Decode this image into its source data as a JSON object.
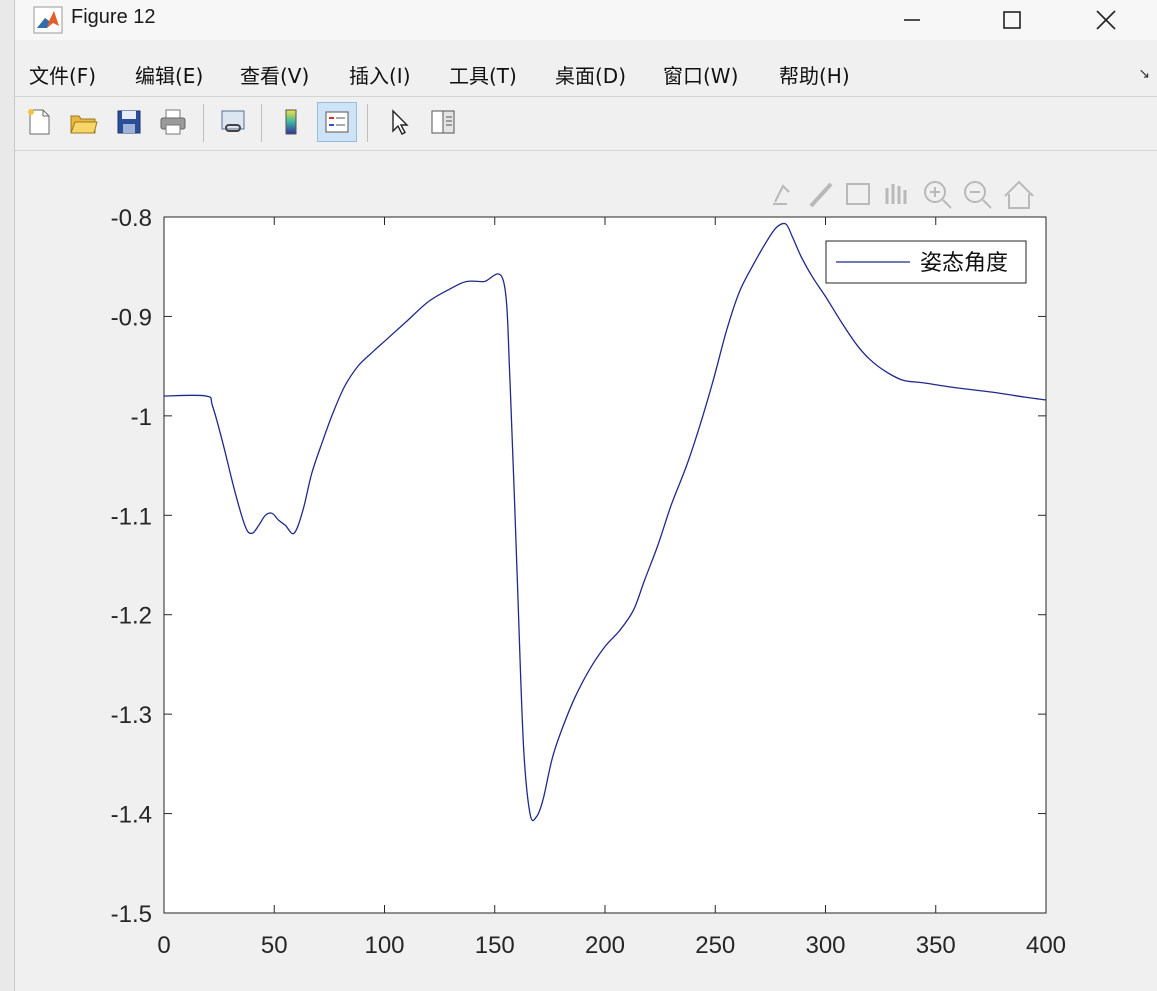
{
  "window": {
    "title": "Figure 12"
  },
  "menu": {
    "items": [
      "文件(F)",
      "编辑(E)",
      "查看(V)",
      "插入(I)",
      "工具(T)",
      "桌面(D)",
      "窗口(W)",
      "帮助(H)"
    ]
  },
  "toolbar": {
    "icons": [
      "new-figure-icon",
      "open-file-icon",
      "save-icon",
      "print-icon",
      "link-plot-icon",
      "colorbar-icon",
      "legend-icon",
      "pointer-icon",
      "property-editor-icon"
    ]
  },
  "axes_toolbar": {
    "icons": [
      "export-icon",
      "brush-icon",
      "data-tips-icon",
      "pan-icon",
      "zoom-in-icon",
      "zoom-out-icon",
      "home-icon"
    ]
  },
  "colors": {
    "line": "#1f2a8a",
    "axes_bg": "#ffffff",
    "figure_bg": "#f0f0f0"
  },
  "chart_data": {
    "type": "line",
    "xlim": [
      0,
      400
    ],
    "ylim": [
      -1.5,
      -0.8
    ],
    "xticks": [
      0,
      50,
      100,
      150,
      200,
      250,
      300,
      350,
      400
    ],
    "yticks": [
      -0.8,
      -0.9,
      -1,
      -1.1,
      -1.2,
      -1.3,
      -1.4,
      -1.5
    ],
    "xtick_labels": [
      "0",
      "50",
      "100",
      "150",
      "200",
      "250",
      "300",
      "350",
      "400"
    ],
    "ytick_labels": [
      "-0.8",
      "-0.9",
      "-1",
      "-1.1",
      "-1.2",
      "-1.3",
      "-1.4",
      "-1.5"
    ],
    "grid": false,
    "legend_position": "top-right",
    "series": [
      {
        "name": "姿态角度",
        "x": [
          0,
          19,
          22,
          27,
          32,
          37,
          40,
          43,
          46,
          49,
          52,
          55,
          59,
          63,
          67,
          72,
          77,
          82,
          88,
          95,
          100,
          110,
          120,
          130,
          137,
          145,
          154,
          157,
          160,
          163,
          166,
          169,
          172,
          176,
          180,
          186,
          193,
          200,
          207,
          213,
          218,
          224,
          230,
          237,
          243,
          249,
          255,
          261,
          268,
          274,
          278,
          282,
          285,
          289,
          294,
          300,
          307,
          314,
          320,
          327,
          335,
          345,
          360,
          375,
          390,
          400
        ],
        "y": [
          -0.98,
          -0.98,
          -0.99,
          -1.03,
          -1.075,
          -1.112,
          -1.118,
          -1.11,
          -1.1,
          -1.098,
          -1.105,
          -1.11,
          -1.118,
          -1.095,
          -1.058,
          -1.025,
          -0.995,
          -0.97,
          -0.95,
          -0.935,
          -0.925,
          -0.905,
          -0.885,
          -0.872,
          -0.865,
          -0.865,
          -0.865,
          -0.97,
          -1.15,
          -1.33,
          -1.4,
          -1.403,
          -1.385,
          -1.345,
          -1.318,
          -1.285,
          -1.255,
          -1.232,
          -1.215,
          -1.195,
          -1.165,
          -1.13,
          -1.09,
          -1.05,
          -1.01,
          -0.965,
          -0.915,
          -0.875,
          -0.845,
          -0.822,
          -0.81,
          -0.807,
          -0.82,
          -0.84,
          -0.86,
          -0.88,
          -0.905,
          -0.928,
          -0.943,
          -0.955,
          -0.964,
          -0.967,
          -0.972,
          -0.976,
          -0.981,
          -0.984
        ]
      }
    ]
  }
}
